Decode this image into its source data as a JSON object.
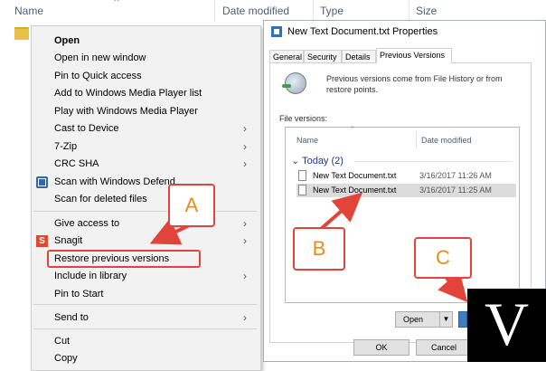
{
  "explorer": {
    "columns": [
      "Name",
      "Date modified",
      "Type",
      "Size"
    ]
  },
  "context_menu": {
    "items": [
      {
        "label": "Open"
      },
      {
        "label": "Open in new window"
      },
      {
        "label": "Pin to Quick access"
      },
      {
        "label": "Add to Windows Media Player list"
      },
      {
        "label": "Play with Windows Media Player"
      },
      {
        "label": "Cast to Device"
      },
      {
        "label": "7-Zip"
      },
      {
        "label": "CRC SHA"
      },
      {
        "label": "Scan with Windows Defend"
      },
      {
        "label": "Scan for deleted files"
      },
      {
        "label": "Give access to"
      },
      {
        "label": "Snagit"
      },
      {
        "label": "Restore previous versions"
      },
      {
        "label": "Include in library"
      },
      {
        "label": "Pin to Start"
      },
      {
        "label": "Send to"
      },
      {
        "label": "Cut"
      },
      {
        "label": "Copy"
      }
    ]
  },
  "dialog": {
    "title": "New Text Document.txt Properties",
    "tabs": [
      "General",
      "Security",
      "Details",
      "Previous Versions"
    ],
    "info_text": "Previous versions come from File History or from restore points.",
    "file_versions_label": "File versions:",
    "list_columns": [
      "Name",
      "Date modified"
    ],
    "group": "Today (2)",
    "rows": [
      {
        "name": "New Text Document.txt",
        "date": "3/16/2017 11:26 AM"
      },
      {
        "name": "New Text Document.txt",
        "date": "3/16/2017 11:25 AM"
      }
    ],
    "open_label": "Open",
    "ok_label": "OK",
    "cancel_label": "Cancel"
  },
  "annotations": {
    "a": "A",
    "b": "B",
    "c": "C"
  },
  "logo": {
    "glyph": "V"
  },
  "colors": {
    "annotation_red": "#e2443a",
    "annotation_letter": "#e98c1c",
    "title_accent": "#2c6fc3"
  }
}
